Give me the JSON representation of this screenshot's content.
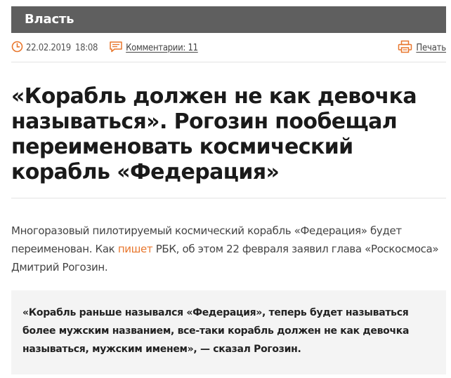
{
  "rubric": {
    "label": "Власть"
  },
  "meta": {
    "date": "22.02.2019",
    "time": "18:08",
    "comments_label": "Комментарии: 11",
    "print_label": "Печать",
    "icons": {
      "clock": "clock-icon",
      "comments": "speech-bubble-icon",
      "print": "printer-icon"
    },
    "accent_color": "#e8762c"
  },
  "article": {
    "headline": "«Корабль должен не как девочка называться». Рогозин пообещал переименовать космический корабль «Федерация»",
    "lead": {
      "before": "Многоразовый пилотируемый космический корабль «Федерация» будет переименован. Как ",
      "link_text": "пишет",
      "after": " РБК, об этом 22 февраля заявил глава «Роскосмоса» Дмитрий Рогозин."
    },
    "quote": "«Корабль раньше назывался «Федерация», теперь будет называться более мужским названием, все-таки корабль должен не как девочка называться, мужским именем», — сказал Рогозин."
  }
}
